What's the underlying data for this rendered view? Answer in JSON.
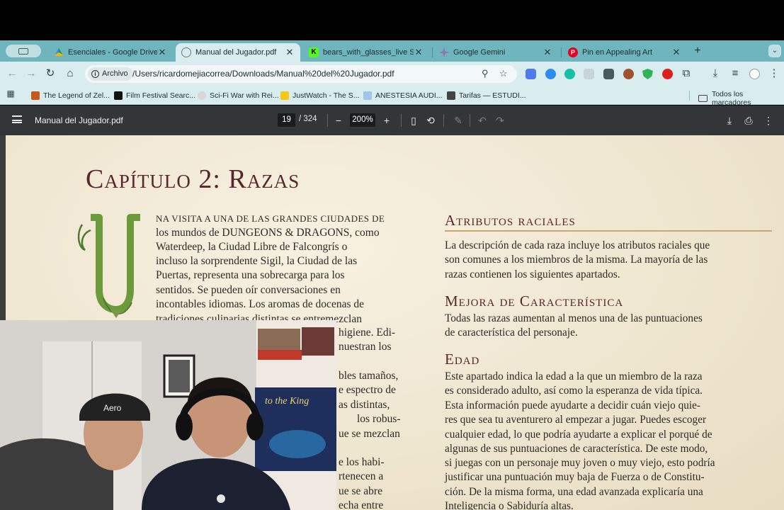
{
  "browser": {
    "tabs": [
      {
        "title": "Esenciales - Google Drive",
        "active": false
      },
      {
        "title": "Manual del Jugador.pdf",
        "active": true
      },
      {
        "title": "bears_with_glasses_live Stre",
        "active": false
      },
      {
        "title": "Google Gemini",
        "active": false
      },
      {
        "title": "Pin en Appealing Art",
        "active": false
      }
    ],
    "origin_chip": "Archivo",
    "url": "/Users/ricardomejiacorrea/Downloads/Manual%20del%20Jugador.pdf",
    "bookmarks": [
      "The Legend of Zel...",
      "Film Festival Searc...",
      "Sci-Fi War with Rei...",
      "JustWatch - The S...",
      "ANESTESIA AUDI...",
      "Tarifas — ESTUDI..."
    ],
    "all_bookmarks": "Todos los marcadores",
    "colors": {
      "tab_strip": "#6fb5bd",
      "toolbar": "#d9ecee"
    }
  },
  "pdf": {
    "title": "Manual del Jugador.pdf",
    "page": "19",
    "total": "/ 324",
    "zoom": "200%",
    "content": {
      "chapter_title": "Capítulo 2: Razas",
      "dropcap_letter": "U",
      "intro_lead": "NA VISITA A UNA DE LAS GRANDES CIUDADES DE",
      "intro_lines": [
        "los mundos de DUNGEONS & DRAGONS, como",
        "Waterdeep, la Ciudad Libre de Falcongrís o",
        "incluso la sorprendente Sigil, la Ciudad de las",
        "Puertas, representa una sobrecarga para los",
        "sentidos. Se pueden oír conversaciones en",
        "incontables idiomas. Los aromas de docenas de",
        "tradiciones culinarias distintas se entremezclan"
      ],
      "intro_fragments": [
        "higiene. Edi-",
        "nuestran los",
        "bles tamaños,",
        "e espectro de",
        "as distintas,",
        "los robus-",
        "ue se mezclan",
        "e los habi-",
        "rtenecen a",
        "ue se abre",
        "echa entre"
      ],
      "sections": [
        {
          "heading": "Atributos raciales",
          "lines": [
            "La descripción de cada raza incluye los atributos raciales que",
            "son comunes a los miembros de la misma. La mayoría de las",
            "razas contienen los siguientes apartados."
          ]
        },
        {
          "heading": "Mejora de Característica",
          "lines": [
            "Todas las razas aumentan al menos una de las puntuaciones",
            "de característica del personaje."
          ]
        },
        {
          "heading": "Edad",
          "lines": [
            "Este apartado indica la edad a la que un miembro de la raza",
            "es considerado adulto, así como la esperanza de vida típica.",
            "Esta información puede ayudarte a decidir cuán viejo quie-",
            "res que sea tu aventurero al empezar a jugar. Puedes escoger",
            "cualquier edad, lo que podría ayudarte a explicar el porqué de",
            "algunas de sus puntuaciones de característica. De este modo,",
            "si juegas con un personaje muy joven o muy viejo, esto podría",
            "justificar una puntuación muy baja de Fuerza o de Constitu-",
            "ción. De la misma forma, una edad avanzada explicaría una",
            "Inteligencia o Sabiduría altas."
          ]
        }
      ]
    }
  },
  "webcam": {
    "cap_text": "Aero",
    "poster_text": "to the King"
  }
}
